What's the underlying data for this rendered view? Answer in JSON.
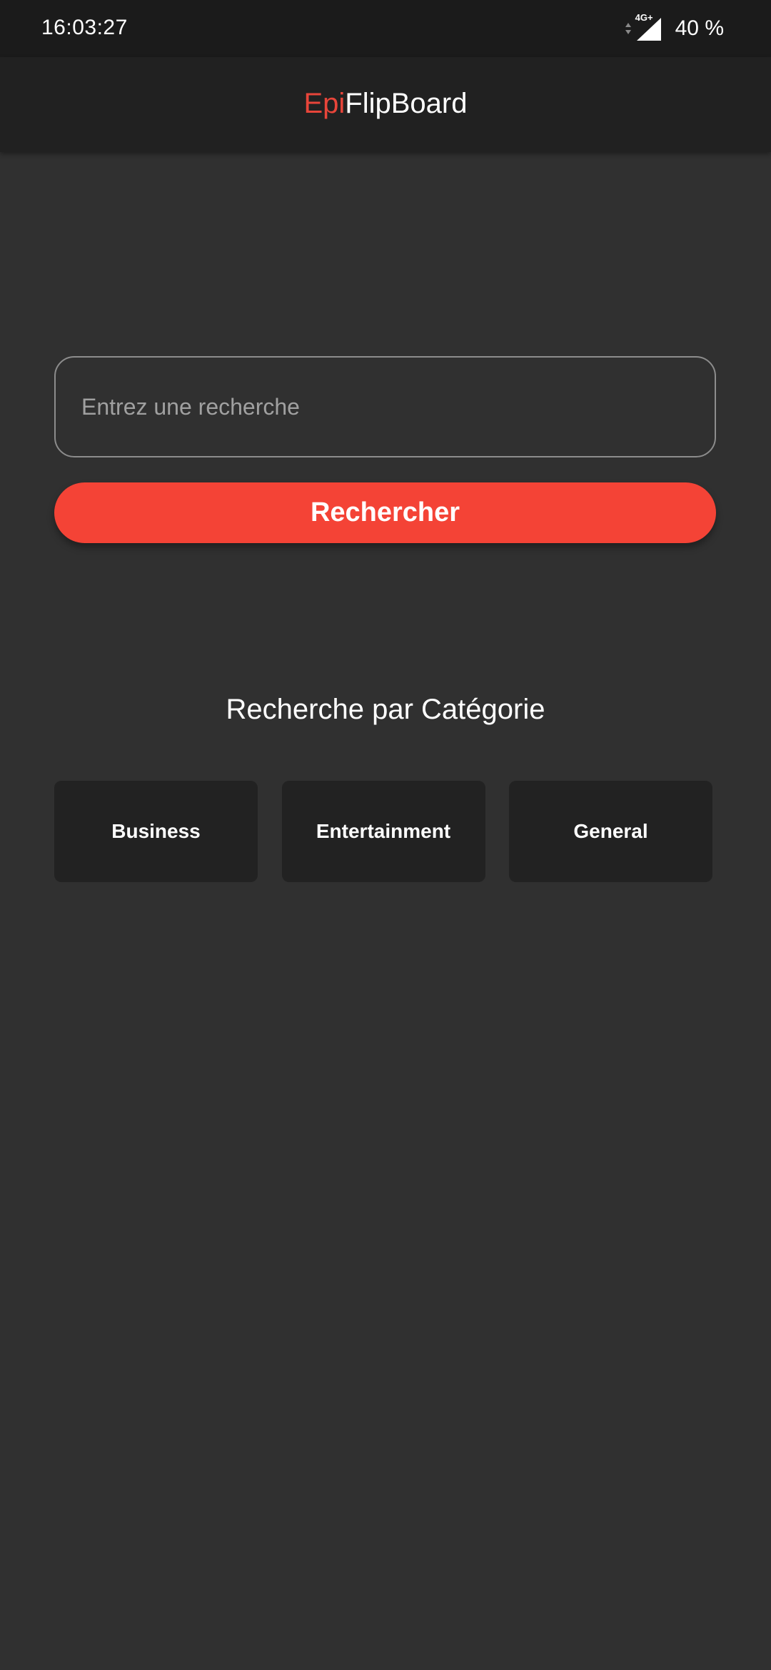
{
  "status_bar": {
    "time": "16:03:27",
    "network_type": "4G+",
    "battery": "40 %"
  },
  "app_bar": {
    "title_accent": "Epi",
    "title_main": "FlipBoard"
  },
  "search": {
    "placeholder": "Entrez une recherche",
    "value": "",
    "button_label": "Rechercher"
  },
  "categories": {
    "heading": "Recherche par Catégorie",
    "items": [
      {
        "label": "Business"
      },
      {
        "label": "Entertainment"
      },
      {
        "label": "General"
      }
    ]
  },
  "colors": {
    "accent": "#f44336",
    "title_accent": "#e8453a",
    "background": "#303030",
    "app_bar": "#212121",
    "status_bar": "#1b1b1b",
    "card": "#222222"
  },
  "icons": {
    "network_arrows": "data-arrows-icon",
    "signal": "signal-strength-icon"
  }
}
